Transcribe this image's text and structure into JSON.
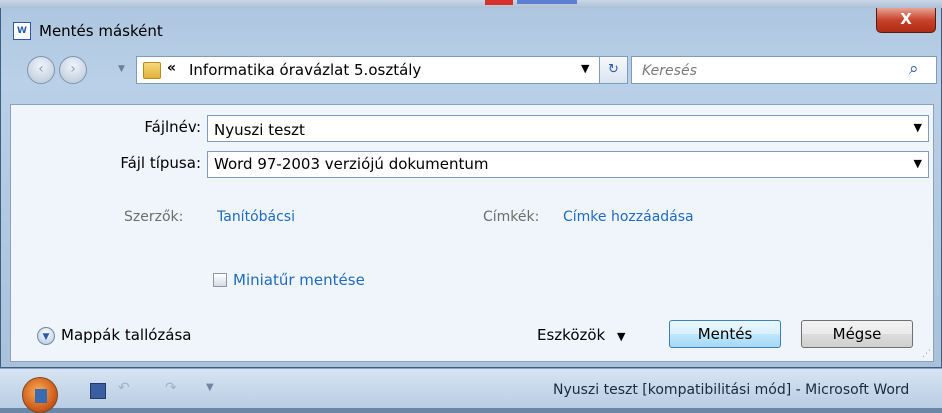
{
  "window": {
    "title": "Mentés másként",
    "app_icon": "word-doc-icon",
    "close_glyph": "X"
  },
  "nav": {
    "back_glyph": "‹",
    "forward_glyph": "›",
    "breadcrumb_separator": "«",
    "path": "Informatika óravázlat 5.osztály",
    "search_placeholder": "Keresés"
  },
  "form": {
    "filename_label": "Fájlnév:",
    "filename_value": "Nyuszi teszt",
    "filetype_label": "Fájl típusa:",
    "filetype_value": "Word 97-2003 verziójú dokumentum",
    "authors_label": "Szerzők:",
    "authors_value": "Tanítóbácsi",
    "tags_label": "Címkék:",
    "tags_value": "Címke hozzáadása",
    "thumbnail_label": "Miniatűr mentése"
  },
  "footer": {
    "browse_folders": "Mappák tallózása",
    "tools": "Eszközök",
    "save": "Mentés",
    "cancel": "Mégse"
  },
  "taskbar": {
    "title": "Nyuszi teszt [kompatibilitási mód] - Microsoft Word"
  },
  "colors": {
    "accent": "#1f6bc1",
    "close": "#c8432c"
  }
}
